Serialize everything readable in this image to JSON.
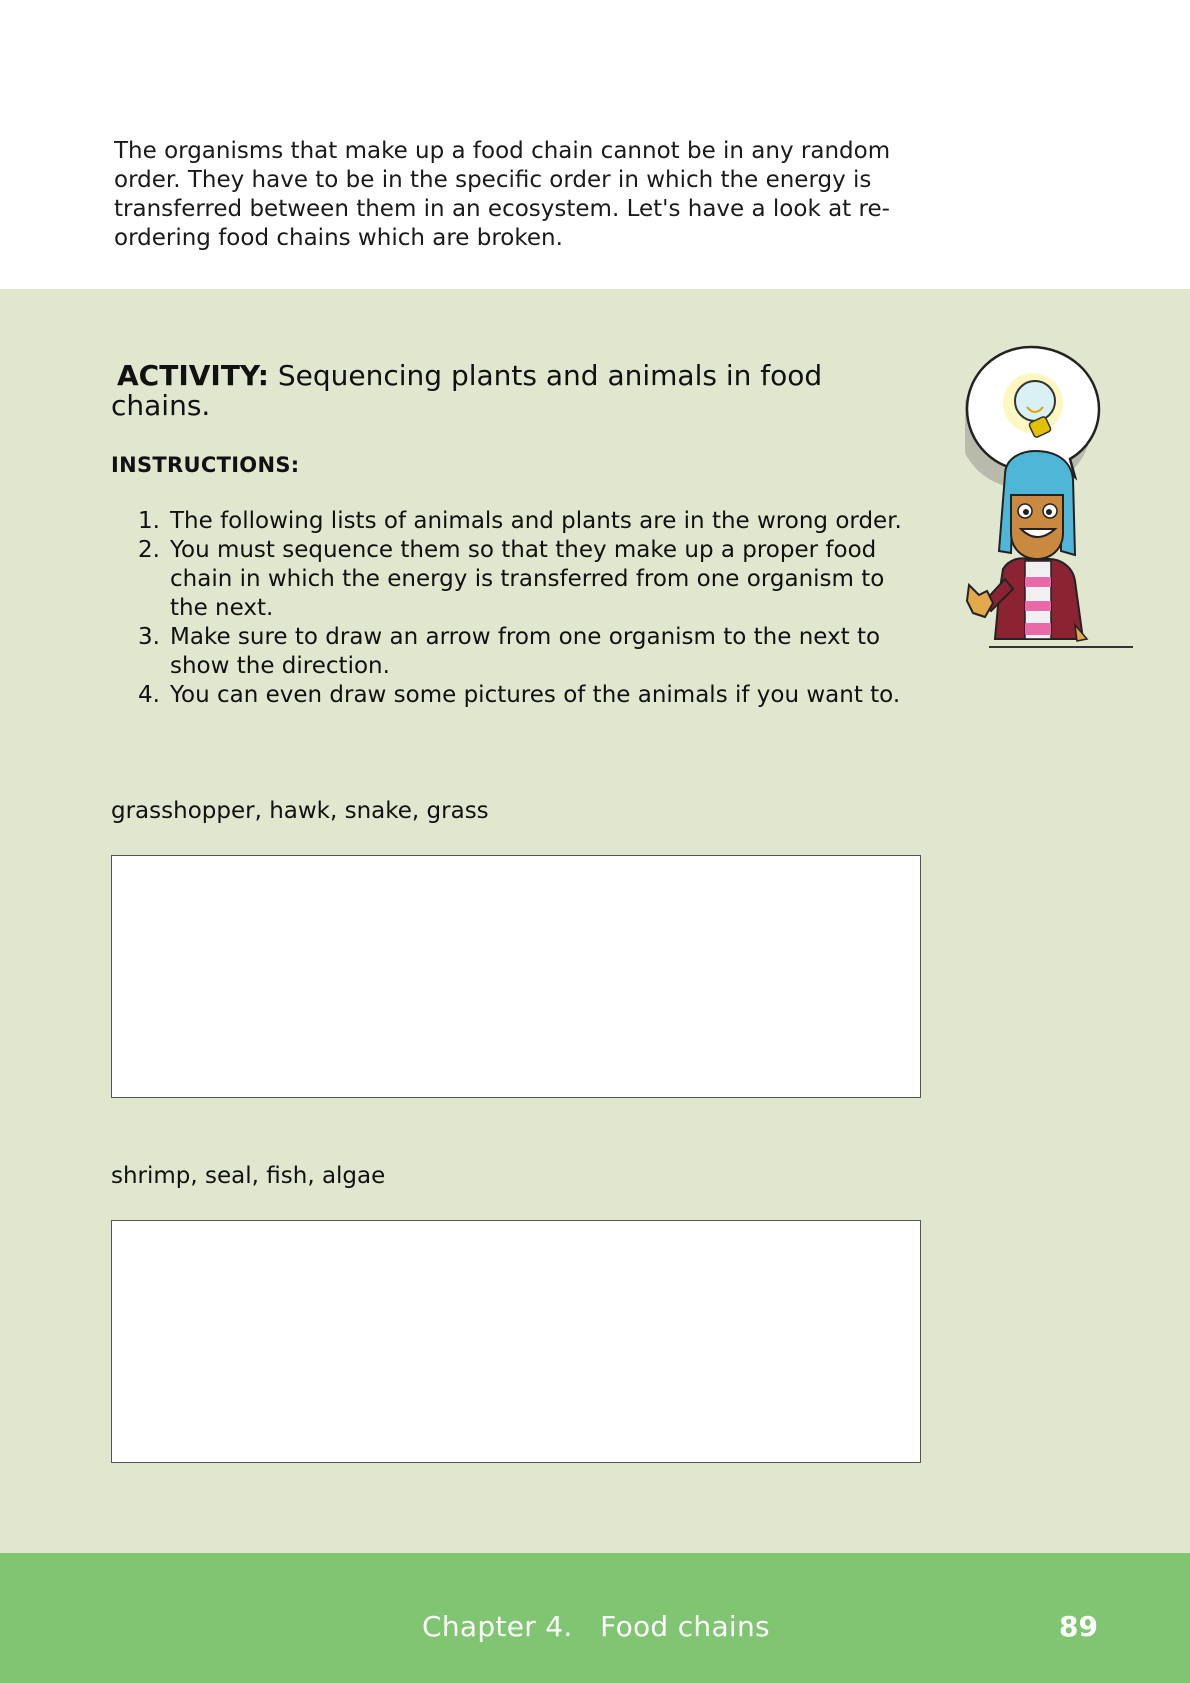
{
  "intro": {
    "text": "The organisms that make up a food chain cannot be in any random order. They have to be in the specific order in which the energy is transferred between them in an ecosystem. Let's have a look at re-ordering food chains which are broken."
  },
  "activity": {
    "label": "ACTIVITY:",
    "title": "Sequencing plants and animals in food chains.",
    "instructions_heading": "INSTRUCTIONS:",
    "instructions": [
      {
        "num": "1.",
        "text": "The following lists of animals and plants are in the wrong order."
      },
      {
        "num": "2.",
        "text": "You must sequence them so that they make up a proper food chain in which the energy is transferred from one organism to the next."
      },
      {
        "num": "3.",
        "text": "Make sure to draw an arrow from one organism to the next to show the direction."
      },
      {
        "num": "4.",
        "text": "You can even draw some pictures of the animals if you want to."
      }
    ],
    "chains": [
      {
        "label": "grasshopper, hawk, snake, grass"
      },
      {
        "label": "shrimp, seal, fish, algae"
      }
    ]
  },
  "footer": {
    "chapter": "Chapter 4.   Food chains",
    "page_number": "89"
  },
  "colors": {
    "panel": "#e1e6cf",
    "footer": "#80c672"
  },
  "mascot": {
    "icon": "girl-with-lightbulb-idea-icon"
  }
}
